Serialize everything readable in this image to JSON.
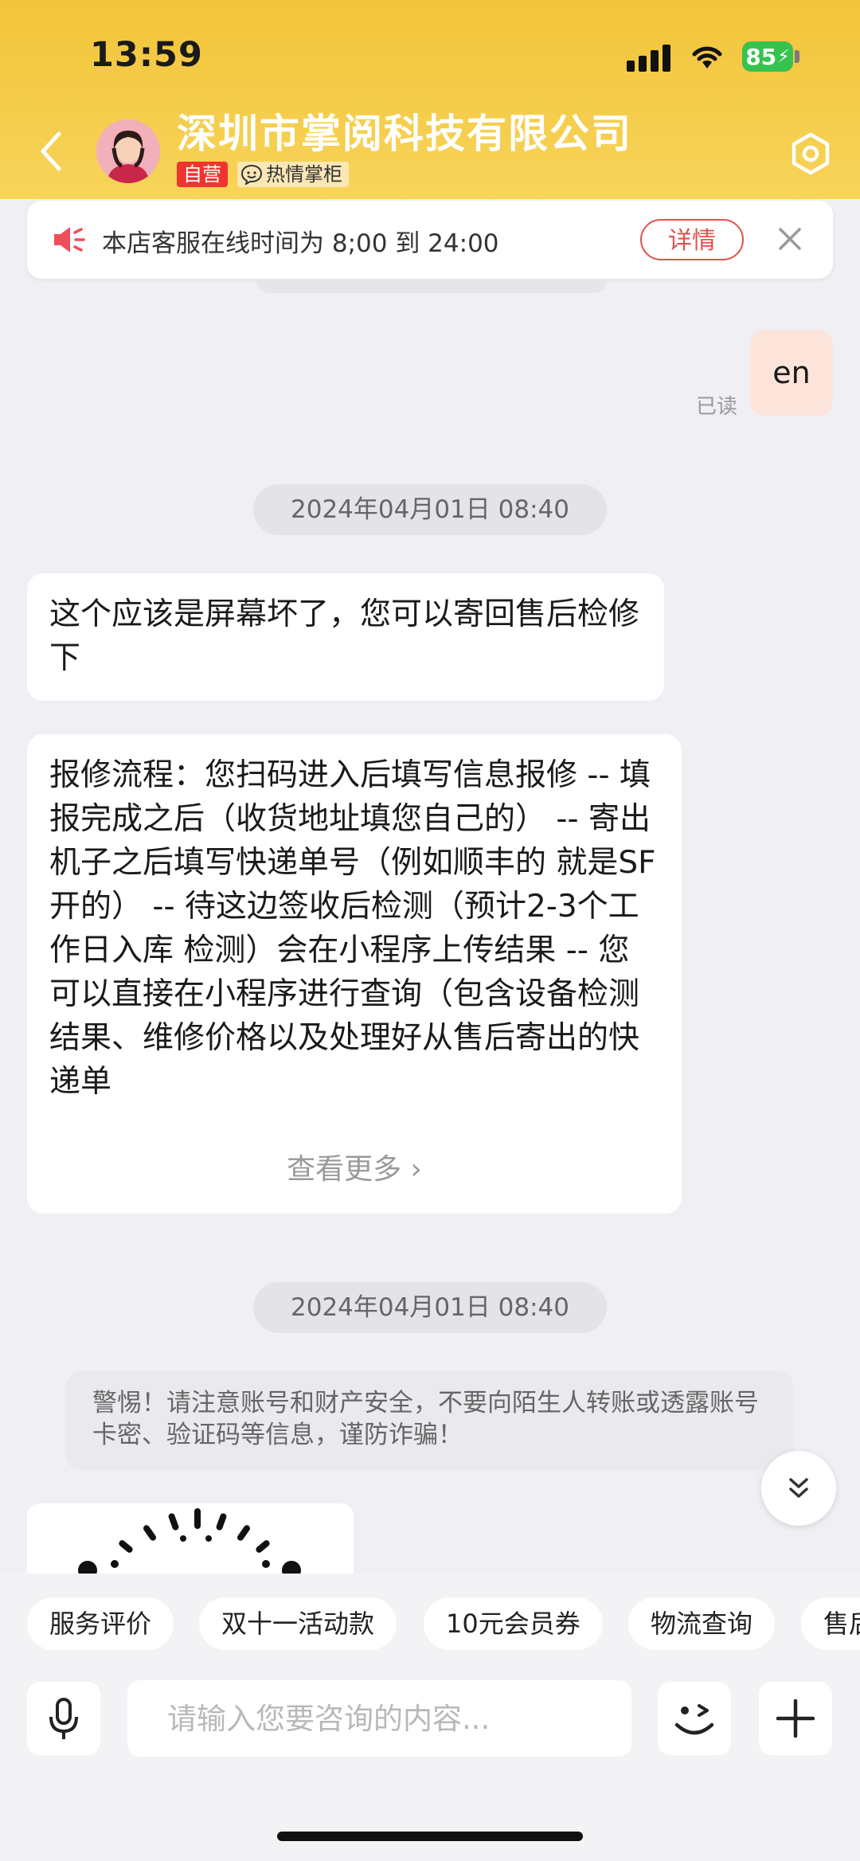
{
  "status": {
    "time": "13:59",
    "battery": "85"
  },
  "header": {
    "shop_name": "深圳市掌阅科技有限公司",
    "tag_self": "自营",
    "tag_hot": "热情掌柜"
  },
  "notice": {
    "text": "本店客服在线时间为 8;00 到 24:00",
    "detail_label": "详情"
  },
  "messages": {
    "outgoing_text": "en",
    "read_label": "已读",
    "timestamp_1": "2024年04月01日 08:40",
    "reply_1": "这个应该是屏幕坏了，您可以寄回售后检修下",
    "reply_2": "报修流程：您扫码进入后填写信息报修 -- 填报完成之后（收货地址填您自己的） -- 寄出机子之后填写快递单号（例如顺丰的 就是SF开的） -- 待这边签收后检测（预计2-3个工作日入库 检测）会在小程序上传结果 -- 您可以直接在小程序进行查询（包含设备检测结果、维修价格以及处理好从售后寄出的快递单",
    "see_more": "查看更多 ›",
    "timestamp_2": "2024年04月01日 08:40",
    "warning": "警惕！请注意账号和财产安全，不要向陌生人转账或透露账号卡密、验证码等信息，谨防诈骗！"
  },
  "quick_replies": [
    "服务评价",
    "双十一活动款",
    "10元会员券",
    "物流查询",
    "售后"
  ],
  "input": {
    "placeholder": "请输入您要咨询的内容..."
  },
  "colors": {
    "header": "#f5cb45",
    "accent_red": "#e3514b",
    "bubble_out": "#fce4da",
    "background": "#efeff4"
  }
}
